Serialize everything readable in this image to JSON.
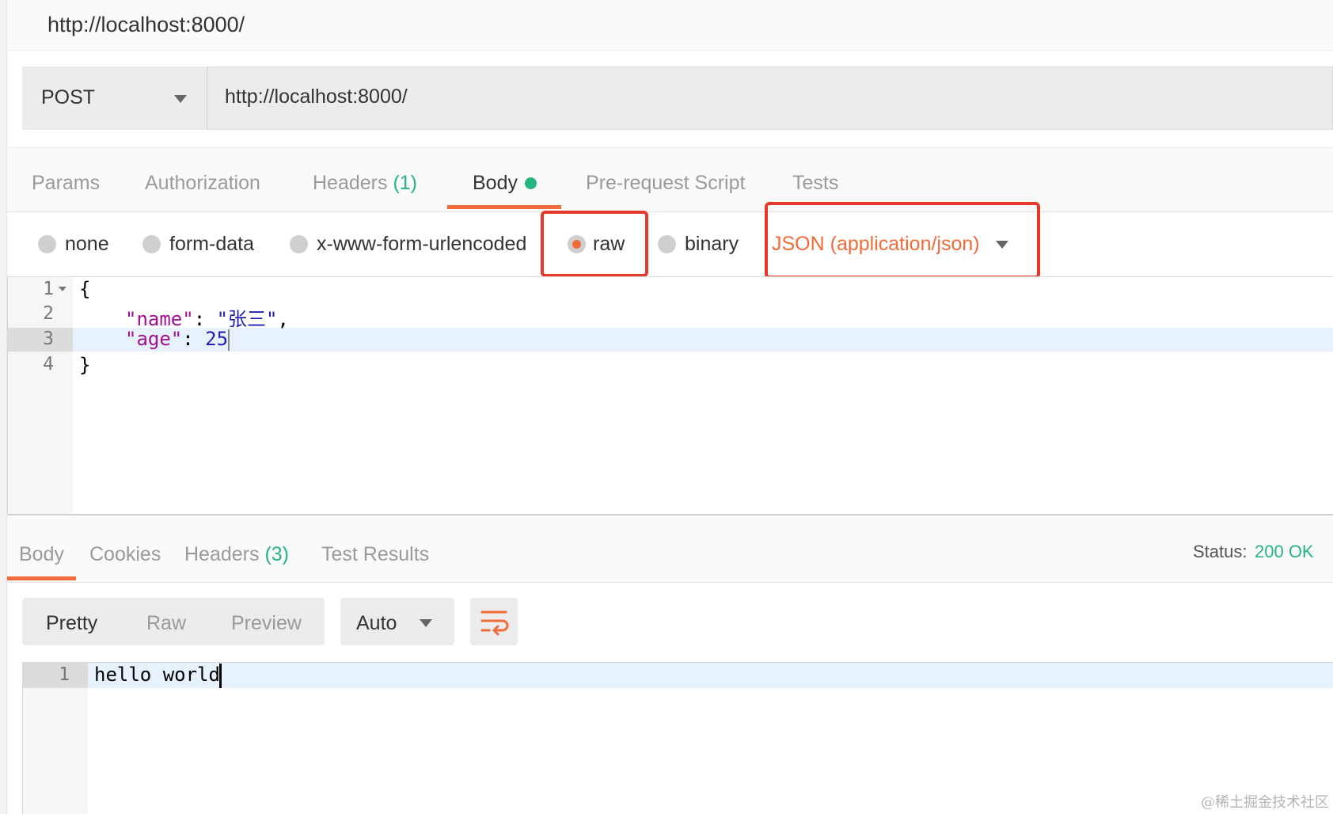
{
  "window": {
    "title": "http://localhost:8000/"
  },
  "request": {
    "method": "POST",
    "url": "http://localhost:8000/",
    "tabs": [
      {
        "label": "Params"
      },
      {
        "label": "Authorization"
      },
      {
        "label": "Headers",
        "count": "(1)"
      },
      {
        "label": "Body",
        "active": true,
        "has_content_dot": true
      },
      {
        "label": "Pre-request Script"
      },
      {
        "label": "Tests"
      }
    ],
    "body_modes": [
      {
        "label": "none",
        "selected": false
      },
      {
        "label": "form-data",
        "selected": false
      },
      {
        "label": "x-www-form-urlencoded",
        "selected": false
      },
      {
        "label": "raw",
        "selected": true
      },
      {
        "label": "binary",
        "selected": false
      }
    ],
    "content_type": "JSON (application/json)",
    "editor": {
      "line_numbers": [
        "1",
        "2",
        "3",
        "4"
      ],
      "lines": [
        {
          "open": "{"
        },
        {
          "key": "\"name\"",
          "sep": ": ",
          "value": "\"张三\"",
          "trail": ","
        },
        {
          "key": "\"age\"",
          "sep": ": ",
          "value": "25"
        },
        {
          "close": "}"
        }
      ],
      "active_line": 3
    }
  },
  "response": {
    "tabs": [
      {
        "label": "Body",
        "active": true
      },
      {
        "label": "Cookies"
      },
      {
        "label": "Headers",
        "count": "(3)"
      },
      {
        "label": "Test Results"
      }
    ],
    "status_label": "Status:",
    "status_value": "200 OK",
    "format_modes": [
      "Pretty",
      "Raw",
      "Preview"
    ],
    "active_format": "Pretty",
    "language": "Auto",
    "line_numbers": [
      "1"
    ],
    "body_text": "hello world"
  },
  "watermark": "@稀土掘金技术社区",
  "colors": {
    "accent": "#f26b3a",
    "success": "#26b47f",
    "highlight_box": "#e53a2b"
  },
  "icons": {
    "method_dropdown": "chevron-down-icon",
    "content_type_dropdown": "chevron-down-icon",
    "wrap": "wrap-lines-icon",
    "fold": "fold-arrow-icon"
  }
}
